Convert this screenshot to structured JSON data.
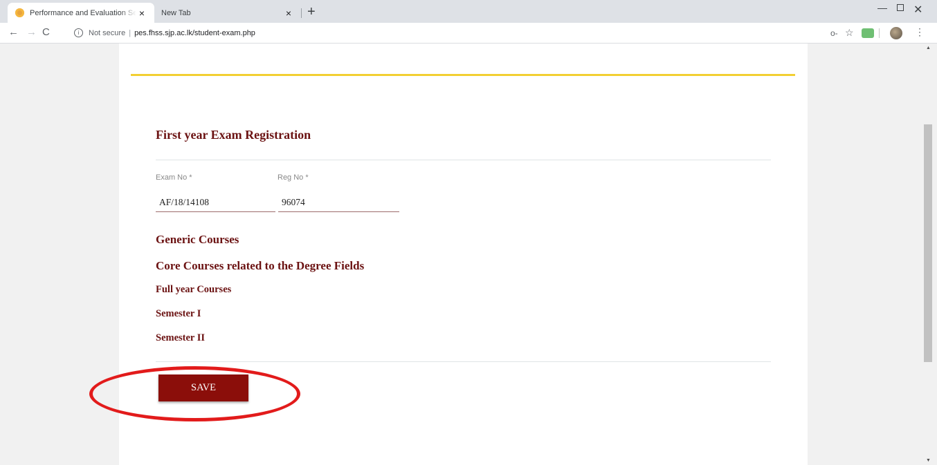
{
  "browser": {
    "tabs": [
      {
        "title": "Performance and Evaluation Serv",
        "active": true
      },
      {
        "title": "New Tab",
        "active": false
      }
    ],
    "new_tab": "+",
    "tab_close": "×",
    "window_controls": {
      "minimize": "—",
      "close": "✕"
    },
    "nav": {
      "back": "←",
      "forward": "→",
      "reload": "C"
    },
    "address": {
      "security": "Not secure",
      "separator": "|",
      "url": "pes.fhss.sjp.ac.lk/student-exam.php"
    },
    "icons": {
      "key": "o-",
      "star": "☆",
      "menu": "⋮"
    }
  },
  "form": {
    "heading": "First year Exam Registration",
    "fields": [
      {
        "label": "Exam No *",
        "value": "AF/18/14108"
      },
      {
        "label": "Reg No *",
        "value": "96074"
      }
    ],
    "sections": [
      "Generic Courses",
      "Core Courses related to the Degree Fields",
      "Full year Courses",
      "Semester I",
      "Semester II"
    ],
    "save_label": "SAVE"
  },
  "colors": {
    "accent": "#6b1212",
    "button": "#8b0e0a",
    "gold_line": "#f2cf32",
    "annotation": "#e21b1b"
  }
}
